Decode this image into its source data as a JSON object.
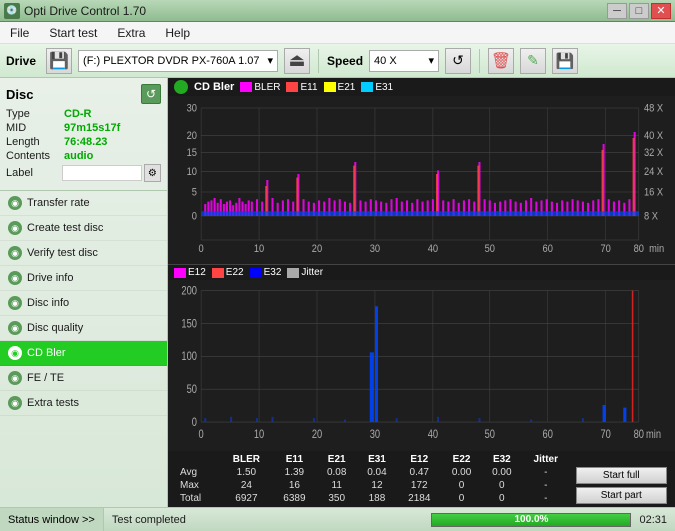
{
  "titlebar": {
    "title": "Opti Drive Control 1.70",
    "icon": "💿",
    "controls": {
      "minimize": "─",
      "maximize": "□",
      "close": "✕"
    }
  },
  "menubar": {
    "items": [
      "File",
      "Start test",
      "Extra",
      "Help"
    ]
  },
  "toolbar": {
    "drive_label": "Drive",
    "drive_icon": "💾",
    "drive_value": "(F:)  PLEXTOR DVDR  PX-760A 1.07",
    "speed_label": "Speed",
    "speed_value": "40 X",
    "eject_symbol": "⏏",
    "refresh_symbol": "↺",
    "erase_symbol": "🗑",
    "write_symbol": "✎",
    "save_symbol": "💾"
  },
  "sidebar": {
    "disc_title": "Disc",
    "disc_refresh": "↺",
    "disc_info": [
      {
        "key": "Type",
        "value": "CD-R",
        "colored": true
      },
      {
        "key": "MID",
        "value": "97m15s17f",
        "colored": true
      },
      {
        "key": "Length",
        "value": "76:48.23",
        "colored": true
      },
      {
        "key": "Contents",
        "value": "audio",
        "colored": true
      },
      {
        "key": "Label",
        "value": "",
        "colored": false
      }
    ],
    "menu_items": [
      {
        "id": "transfer-rate",
        "label": "Transfer rate",
        "active": false
      },
      {
        "id": "create-test-disc",
        "label": "Create test disc",
        "active": false
      },
      {
        "id": "verify-test-disc",
        "label": "Verify test disc",
        "active": false
      },
      {
        "id": "drive-info",
        "label": "Drive info",
        "active": false
      },
      {
        "id": "disc-info",
        "label": "Disc info",
        "active": false
      },
      {
        "id": "disc-quality",
        "label": "Disc quality",
        "active": false
      },
      {
        "id": "cd-bler",
        "label": "CD Bler",
        "active": true
      },
      {
        "id": "fe-te",
        "label": "FE / TE",
        "active": false
      },
      {
        "id": "extra-tests",
        "label": "Extra tests",
        "active": false
      }
    ],
    "status_btn": "Status window >>"
  },
  "chart_top": {
    "title": "CD Bler",
    "legend": [
      {
        "label": "BLER",
        "color": "#ff00ff"
      },
      {
        "label": "E11",
        "color": "#ff4444"
      },
      {
        "label": "E21",
        "color": "#ffff00"
      },
      {
        "label": "E31",
        "color": "#00ccff"
      }
    ],
    "y_axis": [
      30,
      20,
      15,
      10,
      5,
      0
    ],
    "x_axis": [
      0,
      10,
      20,
      30,
      40,
      50,
      60,
      70,
      80
    ],
    "x_unit": "min",
    "y2_labels": [
      "48 X",
      "40 X",
      "32 X",
      "24 X",
      "16 X",
      "8 X"
    ]
  },
  "chart_bottom": {
    "legend": [
      {
        "label": "E12",
        "color": "#ff00ff"
      },
      {
        "label": "E22",
        "color": "#ff4444"
      },
      {
        "label": "E32",
        "color": "#0000ff"
      },
      {
        "label": "Jitter",
        "color": "#aaaaaa"
      }
    ],
    "y_axis": [
      200,
      150,
      100,
      50,
      0
    ],
    "x_axis": [
      0,
      10,
      20,
      30,
      40,
      50,
      60,
      70,
      80
    ],
    "x_unit": "min"
  },
  "stats": {
    "headers": [
      "",
      "BLER",
      "E11",
      "E21",
      "E31",
      "E12",
      "E22",
      "E32",
      "Jitter",
      ""
    ],
    "rows": [
      {
        "label": "Avg",
        "bler": "1.50",
        "e11": "1.39",
        "e21": "0.08",
        "e31": "0.04",
        "e12": "0.47",
        "e22": "0.00",
        "e32": "0.00",
        "jitter": "-"
      },
      {
        "label": "Max",
        "bler": "24",
        "e11": "16",
        "e21": "11",
        "e31": "12",
        "e12": "172",
        "e22": "0",
        "e32": "0",
        "jitter": "-"
      },
      {
        "label": "Total",
        "bler": "6927",
        "e11": "6389",
        "e21": "350",
        "e31": "188",
        "e12": "2184",
        "e22": "0",
        "e32": "0",
        "jitter": "-"
      }
    ],
    "btn_start_full": "Start full",
    "btn_start_part": "Start part"
  },
  "statusbar": {
    "window_btn": "Status window >>",
    "status_text": "Test completed",
    "progress": 100,
    "progress_label": "100.0%",
    "time": "02:31"
  },
  "colors": {
    "active_green": "#22cc22",
    "sidebar_bg": "#e0ece0",
    "chart_bg": "#1a1a1a"
  }
}
